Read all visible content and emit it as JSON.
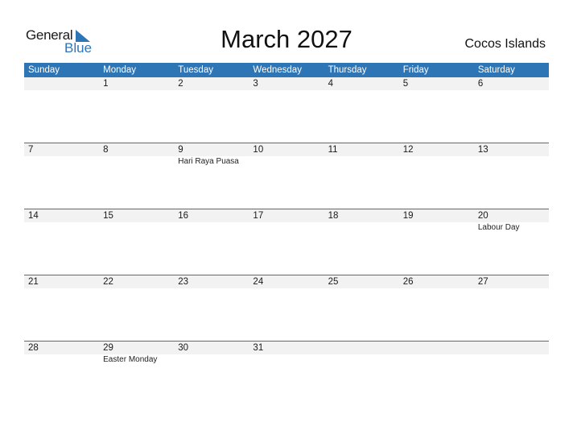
{
  "logo": {
    "line1": "General",
    "line2": "Blue"
  },
  "header": {
    "title": "March 2027",
    "country": "Cocos Islands"
  },
  "colors": {
    "accent": "#2e75b6",
    "day_row_bg": "#f2f2f2"
  },
  "weekdays": [
    "Sunday",
    "Monday",
    "Tuesday",
    "Wednesday",
    "Thursday",
    "Friday",
    "Saturday"
  ],
  "weeks": [
    {
      "days": [
        "",
        "1",
        "2",
        "3",
        "4",
        "5",
        "6"
      ],
      "events": [
        "",
        "",
        "",
        "",
        "",
        "",
        ""
      ]
    },
    {
      "days": [
        "7",
        "8",
        "9",
        "10",
        "11",
        "12",
        "13"
      ],
      "events": [
        "",
        "",
        "Hari Raya Puasa",
        "",
        "",
        "",
        ""
      ]
    },
    {
      "days": [
        "14",
        "15",
        "16",
        "17",
        "18",
        "19",
        "20"
      ],
      "events": [
        "",
        "",
        "",
        "",
        "",
        "",
        "Labour Day"
      ]
    },
    {
      "days": [
        "21",
        "22",
        "23",
        "24",
        "25",
        "26",
        "27"
      ],
      "events": [
        "",
        "",
        "",
        "",
        "",
        "",
        ""
      ]
    },
    {
      "days": [
        "28",
        "29",
        "30",
        "31",
        "",
        "",
        ""
      ],
      "events": [
        "",
        "Easter Monday",
        "",
        "",
        "",
        "",
        ""
      ]
    }
  ]
}
